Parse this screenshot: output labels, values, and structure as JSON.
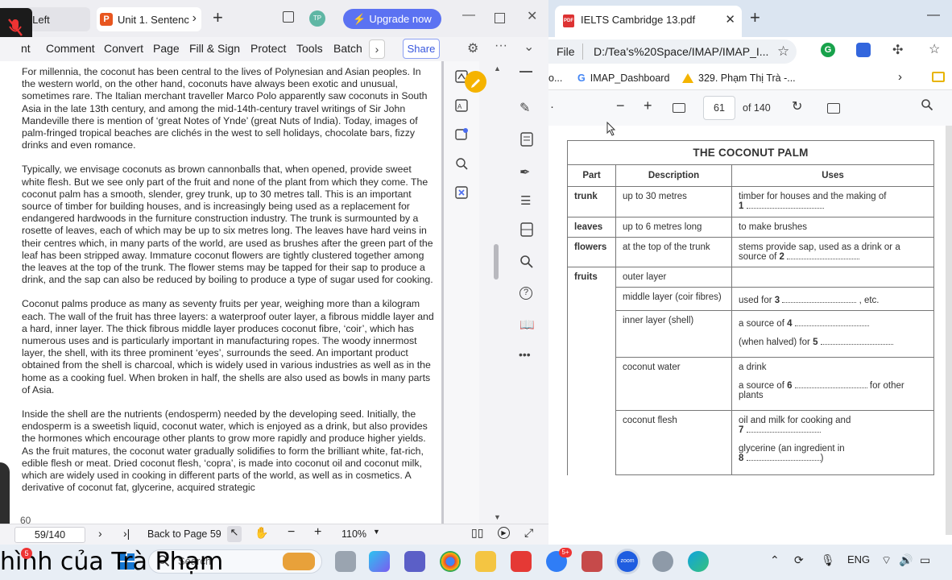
{
  "left_app": {
    "tabs": [
      {
        "label": "y Left"
      },
      {
        "label": "Unit 1. Sentenc",
        "icon_letter": "P"
      }
    ],
    "avatar": "TP",
    "upgrade_label": "Upgrade now",
    "menu": [
      "nt",
      "Comment",
      "Convert",
      "Page",
      "Fill & Sign",
      "Protect",
      "Tools",
      "Batch"
    ],
    "share_label": "Share",
    "paragraphs": [
      "For millennia, the coconut has been central to the lives of Polynesian and Asian peoples. In the western world, on the other hand, coconuts have always been exotic and unusual, sometimes rare. The Italian merchant traveller Marco Polo apparently saw coconuts in South Asia in the late 13th century, and among the mid-14th-century travel writings of Sir John Mandeville there is mention of ‘great Notes of Ynde’ (great Nuts of India). Today, images of palm-fringed tropical beaches are clichés in the west to sell holidays, chocolate bars, fizzy drinks and even romance.",
      "Typically, we envisage coconuts as brown cannonballs that, when opened, provide sweet white flesh. But we see only part of the fruit and none of the plant from which they come. The coconut palm has a smooth, slender, grey trunk, up to 30 metres tall. This is an important source of timber for building houses, and is increasingly being used as a replacement for endangered hardwoods in the furniture construction industry. The trunk is surmounted by a rosette of leaves, each of which may be up to six metres long. The leaves have hard veins in their centres which, in many parts of the world, are used as brushes after the green part of the leaf has been stripped away. Immature coconut flowers are tightly clustered together among the leaves at the top of the trunk. The flower stems may be tapped for their sap to produce a drink, and the sap can also be reduced by boiling to produce a type of sugar used for cooking.",
      "Coconut palms produce as many as seventy fruits per year, weighing more than a kilogram each. The wall of the fruit has three layers: a waterproof outer layer, a fibrous middle layer and a hard, inner layer. The thick fibrous middle layer produces coconut fibre, ‘coir’, which has numerous uses and is particularly important in manufacturing ropes. The woody innermost layer, the shell, with its three prominent ‘eyes’, surrounds the seed. An important product obtained from the shell is charcoal, which is widely used in various industries as well as in the home as a cooking fuel. When broken in half, the shells are also used as bowls in many parts of Asia.",
      "Inside the shell are the nutrients (endosperm) needed by the developing seed. Initially, the endosperm is a sweetish liquid, coconut water, which is enjoyed as a drink, but also provides the hormones which encourage other plants to grow more rapidly and produce higher yields. As the fruit matures, the coconut water gradually solidifies to form the brilliant white, fat-rich, edible flesh or meat. Dried coconut flesh, ‘copra’, is made into coconut oil and coconut milk, which are widely used in cooking in different parts of the world, as well as in cosmetics. A derivative of coconut fat, glycerine, acquired strategic"
    ],
    "page_number_printed": "60",
    "status": {
      "page_field": "59/140",
      "back_to": "Back to Page 59",
      "zoom": "110%"
    }
  },
  "browser": {
    "tab_title": "IELTS Cambridge 13.pdf",
    "tab_icon_text": "PDF",
    "address_scheme": "File",
    "address_url": "D:/Tea's%20Space/IMAP/IMAP_I...",
    "bookmarks": [
      "o...",
      "IMAP_Dashboard",
      "329. Phạm Thị Trà -..."
    ],
    "pdf_page": "61",
    "pdf_total": "of 140"
  },
  "table": {
    "title": "THE COCONUT PALM",
    "headers": [
      "Part",
      "Description",
      "Uses"
    ],
    "trunk": {
      "part": "trunk",
      "desc": "up to 30 metres",
      "use": "timber for houses and the making of",
      "num": "1"
    },
    "leaves": {
      "part": "leaves",
      "desc": "up to 6 metres long",
      "use": "to make brushes"
    },
    "flowers": {
      "part": "flowers",
      "desc": "at the top of the trunk",
      "use": "stems provide sap, used as a drink or a source of",
      "num": "2"
    },
    "fruits_part": "fruits",
    "outer": {
      "desc": "outer layer"
    },
    "middle": {
      "desc": "middle layer (coir fibres)",
      "use_pre": "used for",
      "num": "3",
      "use_post": ", etc."
    },
    "inner": {
      "desc": "inner layer (shell)",
      "use1": "a source of",
      "num1": "4",
      "use2": "(when halved) for",
      "num2": "5"
    },
    "water": {
      "desc": "coconut water",
      "use1": "a drink",
      "use2_pre": "a source of",
      "num": "6",
      "use2_post": "for other plants"
    },
    "flesh": {
      "desc": "coconut flesh",
      "use1": "oil and milk for cooking and",
      "num1": "7",
      "use2": "glycerine (an ingredient in",
      "num2": "8",
      "use2_post": ")"
    }
  },
  "taskbar": {
    "caption": "hình của Trà Phạm",
    "search_placeholder": "Search",
    "lang": "ENG",
    "badge": "5+",
    "zoom_label": "zoom"
  }
}
